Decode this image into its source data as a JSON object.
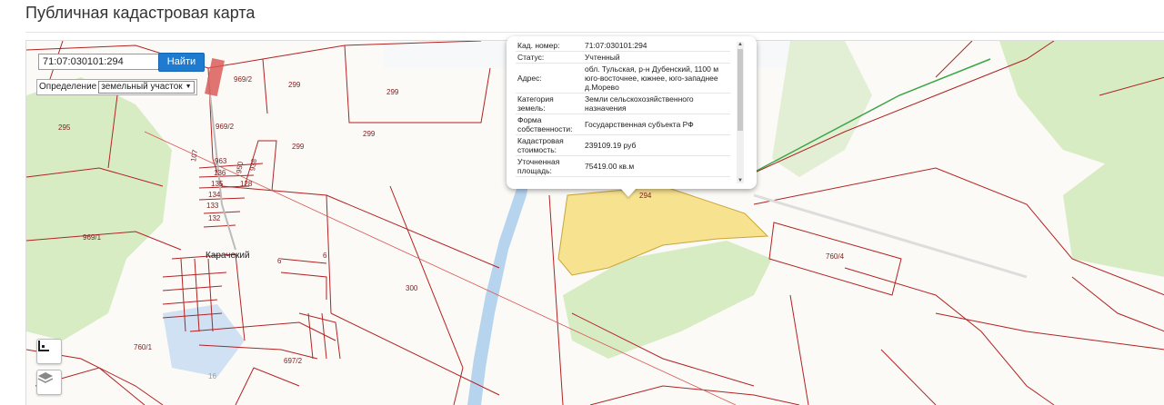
{
  "page": {
    "title": "Публичная кадастровая карта"
  },
  "search": {
    "value": "71:07:030101:294",
    "button_label": "Найти"
  },
  "definition": {
    "label": "Определение",
    "selected": "земельный участок"
  },
  "controls": {
    "bounds_icon": "bounds-icon",
    "layers_icon": "layers-icon"
  },
  "popup": {
    "rows": [
      {
        "label": "Кад. номер:",
        "value": "71:07:030101:294"
      },
      {
        "label": "Статус:",
        "value": "Учтенный"
      },
      {
        "label": "Адрес:",
        "value": "обл. Тульская, р-н Дубенский, 1100 м юго-восточнее, южнее, юго-западнее д.Морево"
      },
      {
        "label": "Категория земель:",
        "value": "Земли сельскохозяйственного назначения"
      },
      {
        "label": "Форма собственности:",
        "value": "Государственная субъекта РФ"
      },
      {
        "label": "Кадастровая стоимость:",
        "value": "239109.19 руб"
      },
      {
        "label": "Уточненная площадь:",
        "value": "75419.00 кв.м"
      }
    ]
  },
  "map_labels": {
    "p969_2_top": "969/2",
    "p299_a": "299",
    "p299_b": "299",
    "p299_c": "299",
    "p299_d": "299",
    "p295": "295",
    "p969_2_mid": "969/2",
    "p969_1": "969/1",
    "p300": "300",
    "p760_4": "760/4",
    "p760_1": "760/1",
    "p697_2": "697/2",
    "p294": "294",
    "p6_a": "6",
    "p6_b": "6",
    "p107": "107",
    "p963": "963",
    "p136": "136",
    "p135": "135",
    "p134": "134",
    "p133": "133",
    "p132": "132",
    "p128": "128",
    "p950": "950",
    "p938": "938",
    "p16": "16",
    "village": "Карачекий"
  },
  "colors": {
    "parcel_line": "#b22222",
    "selected_fill": "#f7e28f",
    "forest": "#d8ecc4",
    "water": "#b7d4ef"
  }
}
